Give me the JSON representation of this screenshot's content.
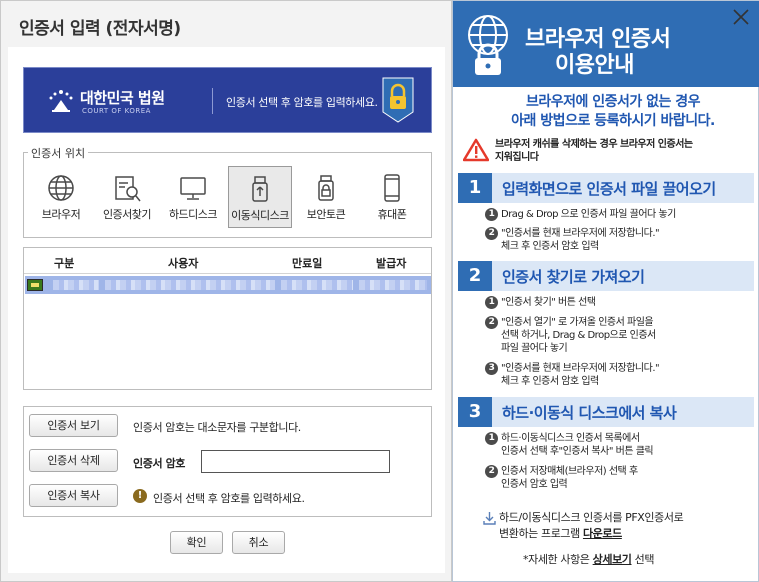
{
  "dialog": {
    "title": "인증서 입력 (전자서명)",
    "banner": {
      "court_name": "대한민국 법원",
      "court_en": "COURT OF KOREA",
      "message": "인증서 선택 후 암호를 입력하세요."
    },
    "location": {
      "legend": "인증서 위치",
      "items": [
        {
          "label": "브라우저",
          "icon": "globe-icon"
        },
        {
          "label": "인증서찾기",
          "icon": "cert-search-icon"
        },
        {
          "label": "하드디스크",
          "icon": "monitor-icon"
        },
        {
          "label": "이동식디스크",
          "icon": "usb-icon",
          "selected": true
        },
        {
          "label": "보안토큰",
          "icon": "security-token-icon"
        },
        {
          "label": "휴대폰",
          "icon": "phone-icon"
        }
      ]
    },
    "table": {
      "headers": [
        "구분",
        "사용자",
        "만료일",
        "발급자"
      ]
    },
    "password": {
      "view_button": "인증서 보기",
      "case_note": "인증서 암호는 대소문자를 구분합니다.",
      "delete_button": "인증서 삭제",
      "pw_label": "인증서 암호",
      "pw_value": "",
      "copy_button": "인증서 복사",
      "hint": "인증서 선택 후 암호를 입력하세요."
    },
    "ok_button": "확인",
    "cancel_button": "취소"
  },
  "panel": {
    "title_line1": "브라우저 인증서",
    "title_line2": "이용안내",
    "intro_line1": "브라우저에 인증서가 없는 경우",
    "intro_line2": "아래 방법으로 등록하시기 바랍니다.",
    "caution_line1": "브라우저 캐쉬를 삭제하는 경우 브라우저 인증서는",
    "caution_line2": "지워집니다",
    "steps": [
      {
        "num": "1",
        "title": "입력화면으로 인증서 파일 끌어오기",
        "items": [
          {
            "n": "1",
            "lines": [
              "Drag & Drop 으로 인증서 파일 끌어다 놓기"
            ]
          },
          {
            "n": "2",
            "lines": [
              "\"인증서를 현재 브라우저에 저장합니다.\"",
              "체크 후 인증서 암호 입력"
            ]
          }
        ]
      },
      {
        "num": "2",
        "title": "인증서 찾기로 가져오기",
        "items": [
          {
            "n": "1",
            "lines": [
              "\"인증서 찾기\" 버튼 선택"
            ]
          },
          {
            "n": "2",
            "lines": [
              "\"인증서 열기\" 로 가져올 인증서 파일을",
              "선택 하거나, Drag & Drop으로 인증서",
              "파일 끌어다 놓기"
            ]
          },
          {
            "n": "3",
            "lines": [
              "\"인증서를 현재 브라우저에 저장합니다.\"",
              "체크 후 인증서 암호 입력"
            ]
          }
        ]
      },
      {
        "num": "3",
        "title": "하드·이동식 디스크에서 복사",
        "items": [
          {
            "n": "1",
            "lines": [
              "하드·이동식디스크 인증서 목록에서",
              "인증서 선택 후\"인증서 복사\" 버튼 클릭"
            ]
          },
          {
            "n": "2",
            "lines": [
              "인증서 저장매체(브라우저) 선택 후",
              "인증서 암호 입력"
            ]
          }
        ]
      }
    ],
    "download_line1": "하드/이동식디스크 인증서를 PFX인증서로",
    "download_line2_prefix": "변환하는 프로그램 ",
    "download_link": "다운로드",
    "detail_prefix": "*자세한 사항은 ",
    "detail_link": "상세보기",
    "detail_suffix": " 선택"
  }
}
